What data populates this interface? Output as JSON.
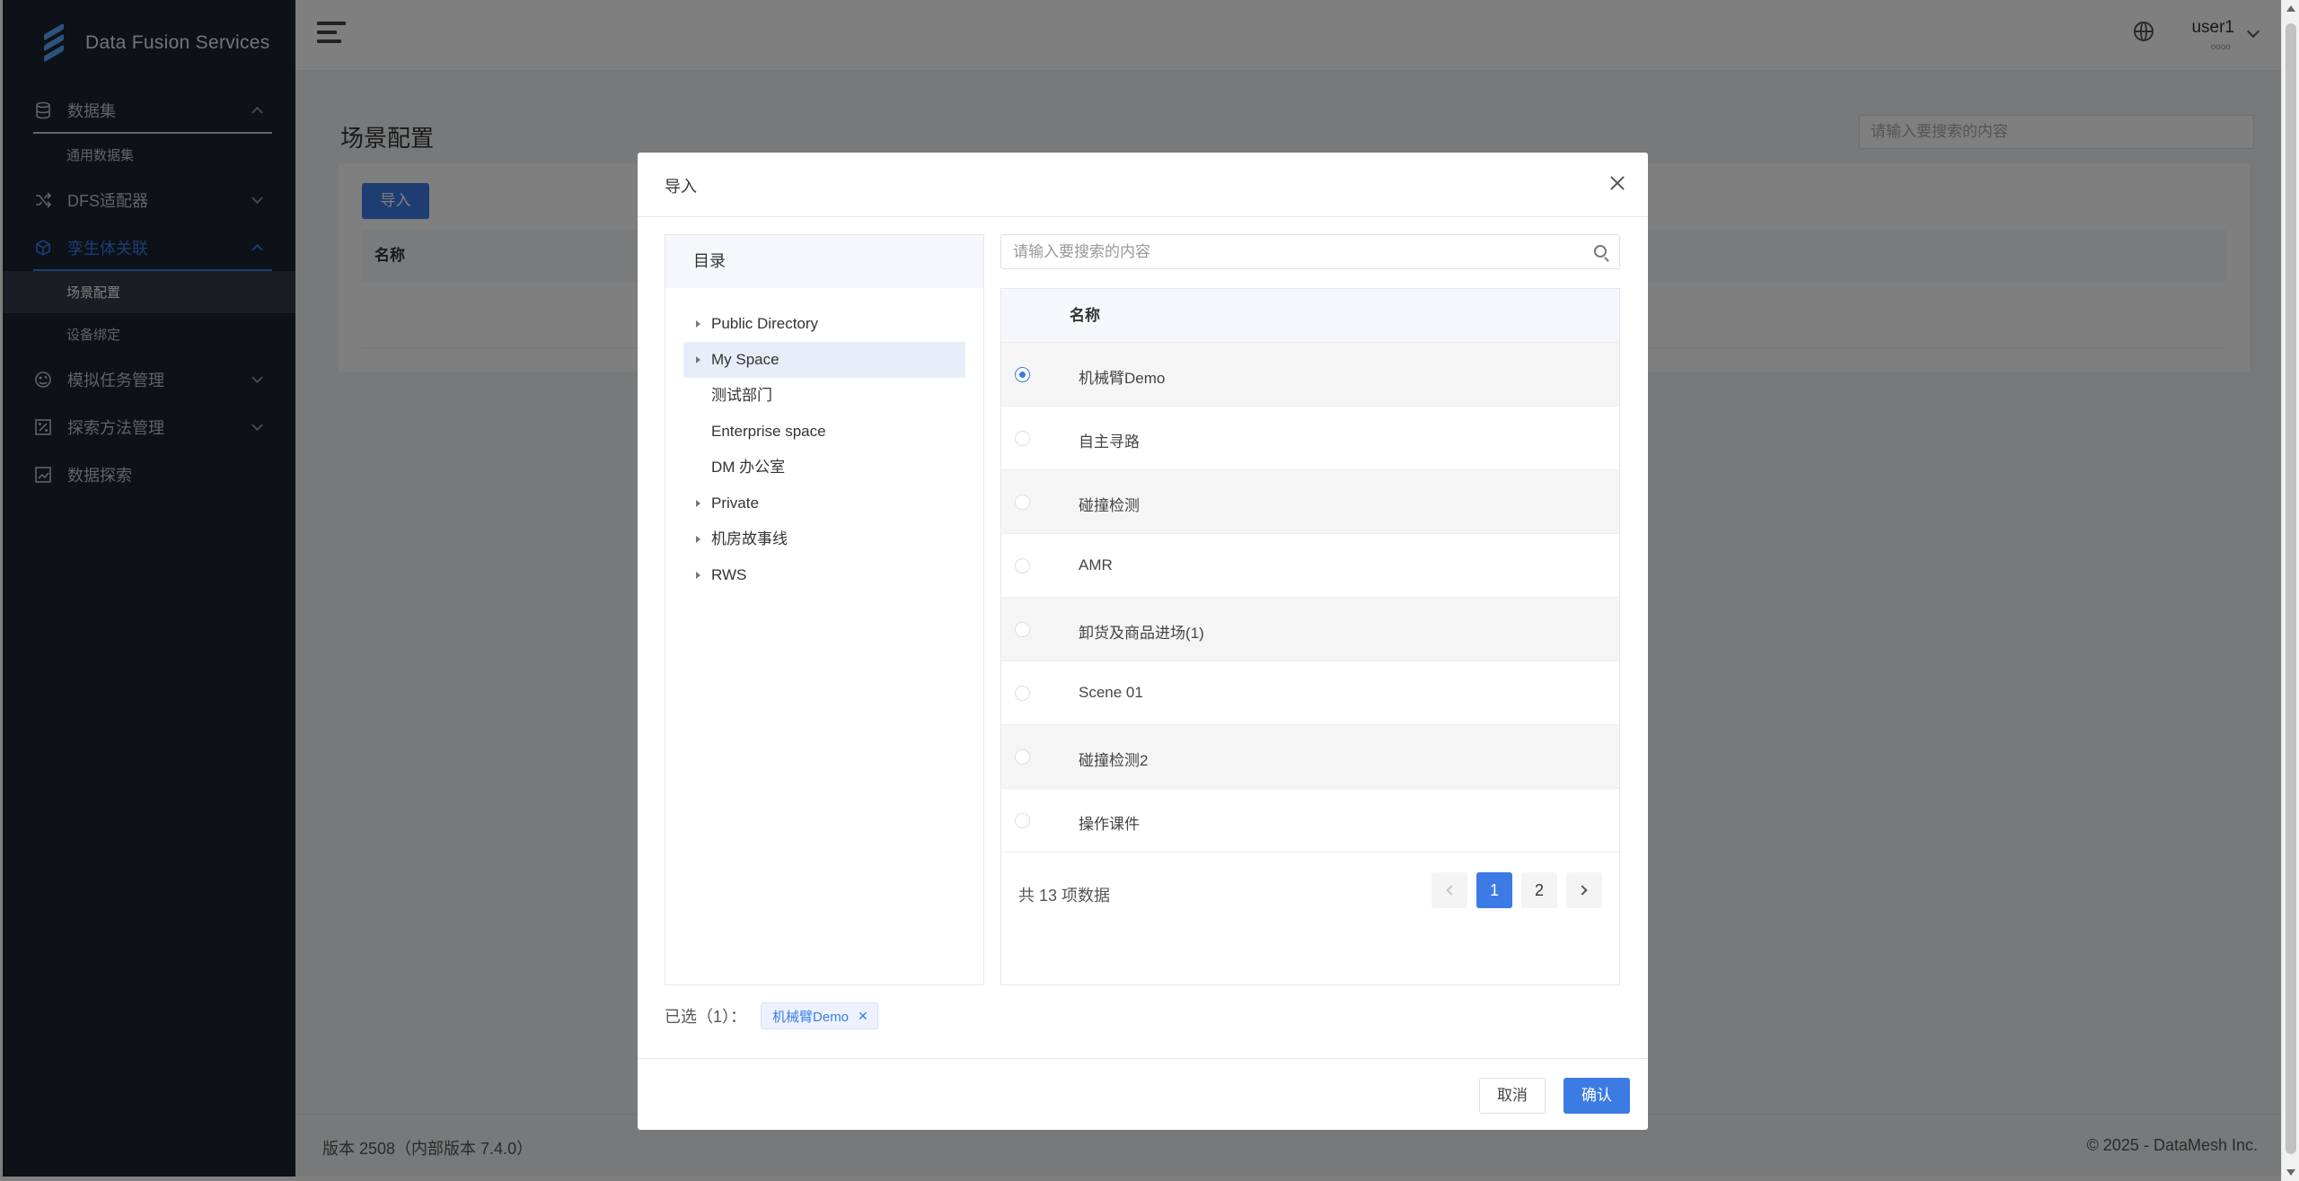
{
  "app": {
    "title": "Data Fusion Services"
  },
  "sidebar": {
    "groups": [
      {
        "label": "数据集",
        "icon": "database-icon",
        "expanded": true,
        "subitems": [
          {
            "label": "通用数据集"
          }
        ]
      },
      {
        "label": "DFS适配器",
        "icon": "shuffle-icon",
        "expanded": false
      },
      {
        "label": "孪生体关联",
        "icon": "cube-icon",
        "expanded": true,
        "active": true,
        "subitems": [
          {
            "label": "场景配置",
            "selected": true
          },
          {
            "label": "设备绑定"
          }
        ]
      },
      {
        "label": "模拟任务管理",
        "icon": "simulation-icon",
        "expanded": false
      },
      {
        "label": "探索方法管理",
        "icon": "percent-icon",
        "expanded": false
      },
      {
        "label": "数据探索",
        "icon": "chart-icon",
        "expanded": false
      }
    ]
  },
  "header": {
    "user": "user1",
    "user_sub": "oooo"
  },
  "page": {
    "title": "场景配置",
    "search_placeholder": "请输入要搜索的内容",
    "import_label": "导入",
    "column_name": "名称"
  },
  "footer": {
    "version": "版本 2508（内部版本 7.4.0）",
    "copyright": "© 2025 - DataMesh Inc."
  },
  "modal": {
    "title": "导入",
    "directory_header": "目录",
    "tree": [
      {
        "label": "Public Directory",
        "has_children": true
      },
      {
        "label": "My Space",
        "has_children": true,
        "selected": true
      },
      {
        "label": "测试部门",
        "has_children": false
      },
      {
        "label": "Enterprise space",
        "has_children": false
      },
      {
        "label": "DM 办公室",
        "has_children": false
      },
      {
        "label": "Private",
        "has_children": true
      },
      {
        "label": "机房故事线",
        "has_children": true
      },
      {
        "label": "RWS",
        "has_children": true
      }
    ],
    "search_placeholder": "请输入要搜索的内容",
    "column_name": "名称",
    "rows": [
      {
        "name": "机械臂Demo",
        "checked": true
      },
      {
        "name": "自主寻路",
        "checked": false
      },
      {
        "name": "碰撞检测",
        "checked": false
      },
      {
        "name": "AMR",
        "checked": false
      },
      {
        "name": "卸货及商品进场(1)",
        "checked": false
      },
      {
        "name": "Scene 01",
        "checked": false
      },
      {
        "name": "碰撞检测2",
        "checked": false
      },
      {
        "name": "操作课件",
        "checked": false
      }
    ],
    "total_text": "共 13 项数据",
    "pages": [
      "1",
      "2"
    ],
    "current_page": 1,
    "selected_label": "已选（1）：",
    "selected_tags": [
      "机械臂Demo"
    ],
    "cancel_label": "取消",
    "confirm_label": "确认"
  },
  "colors": {
    "accent": "#3d7be4",
    "sidebar_bg": "#1b2230",
    "overlay": "rgba(0,0,0,0.5)"
  }
}
